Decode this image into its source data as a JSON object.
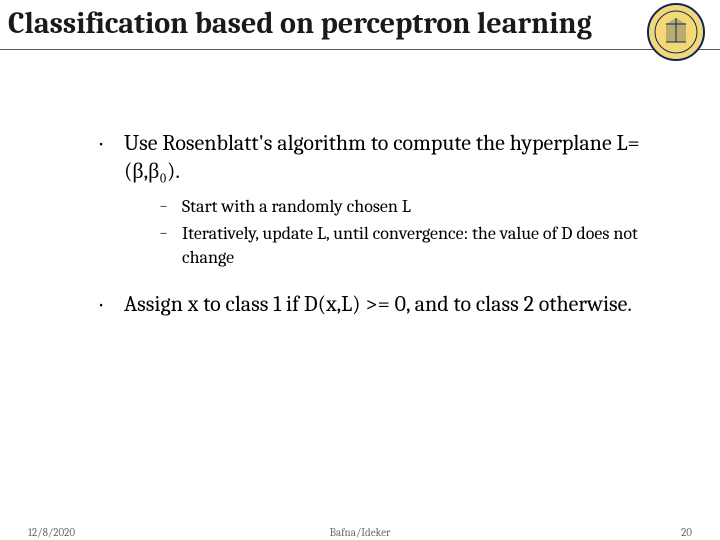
{
  "title": "Classification based on perceptron learning",
  "seal_alt": "University of California San Diego seal",
  "bullets": [
    {
      "text": "Use Rosenblatt's algorithm to compute the hyperplane L=(β,β₀).",
      "sub": [
        "Start with a randomly chosen L",
        "Iteratively, update L, until convergence: the value of D does not change"
      ]
    },
    {
      "text": "Assign x to class 1 if D(x,L) >= 0, and to class 2 otherwise.",
      "sub": []
    }
  ],
  "footer": {
    "date": "12/8/2020",
    "author": "Bafna/Ideker",
    "page": "20"
  }
}
